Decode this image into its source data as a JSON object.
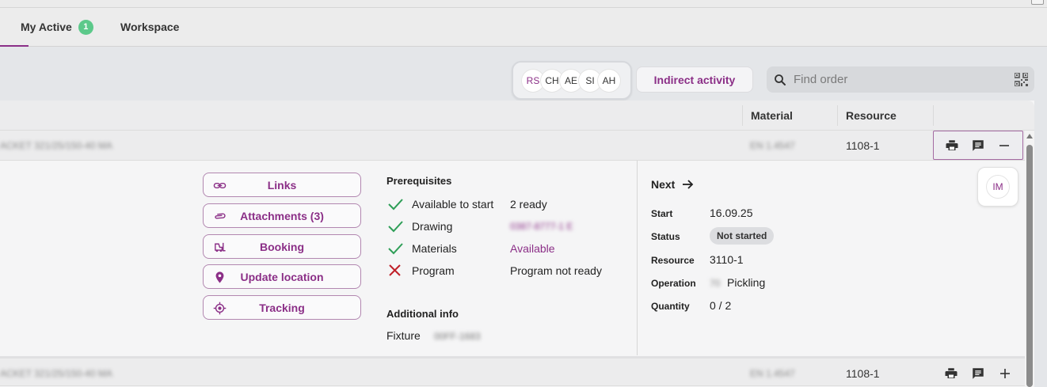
{
  "tabs": [
    {
      "label": "My Active",
      "badge": "1"
    },
    {
      "label": "Workspace"
    }
  ],
  "toolbar": {
    "avatars": [
      "RS",
      "CH",
      "AE",
      "SI",
      "AH"
    ],
    "indirect_label": "Indirect activity",
    "search_placeholder": "Find order"
  },
  "table": {
    "columns": [
      "Material",
      "Resource"
    ],
    "rows": [
      {
        "description_blurred": "ACKET 321/25/150-40 MA",
        "material_blurred": "EN 1.4547",
        "resource": "1108-1",
        "expanded": true
      },
      {
        "description_blurred": "ACKET 321/25/150-40 MA",
        "material_blurred": "EN 1.4547",
        "resource": "1108-1",
        "expanded": false
      }
    ]
  },
  "detail": {
    "buttons": [
      "Links",
      "Attachments (3)",
      "Booking",
      "Update location",
      "Tracking"
    ],
    "prereq_title": "Prerequisites",
    "prereqs": [
      {
        "label": "Available to start",
        "value": "2 ready",
        "ok": true
      },
      {
        "label": "Drawing",
        "value": "0387-8777-1 E",
        "ok": true
      },
      {
        "label": "Materials",
        "value": "Available",
        "ok": true
      },
      {
        "label": "Program",
        "value": "Program not ready",
        "ok": false
      }
    ],
    "additional_title": "Additional info",
    "fixture_label": "Fixture",
    "fixture_value": "00FF-1683",
    "next_title": "Next",
    "fields": {
      "start_label": "Start",
      "start_value": "16.09.25",
      "status_label": "Status",
      "status_value": "Not started",
      "resource_label": "Resource",
      "resource_value": "3110-1",
      "operation_label": "Operation",
      "operation_code": "70",
      "operation_value": "Pickling",
      "quantity_label": "Quantity",
      "quantity_value": "0 / 2"
    },
    "assignee": "IM"
  },
  "colors": {
    "accent": "#8b2f87",
    "ok": "#2e9e57",
    "error": "#c0202a",
    "badge": "#5cc98a"
  }
}
